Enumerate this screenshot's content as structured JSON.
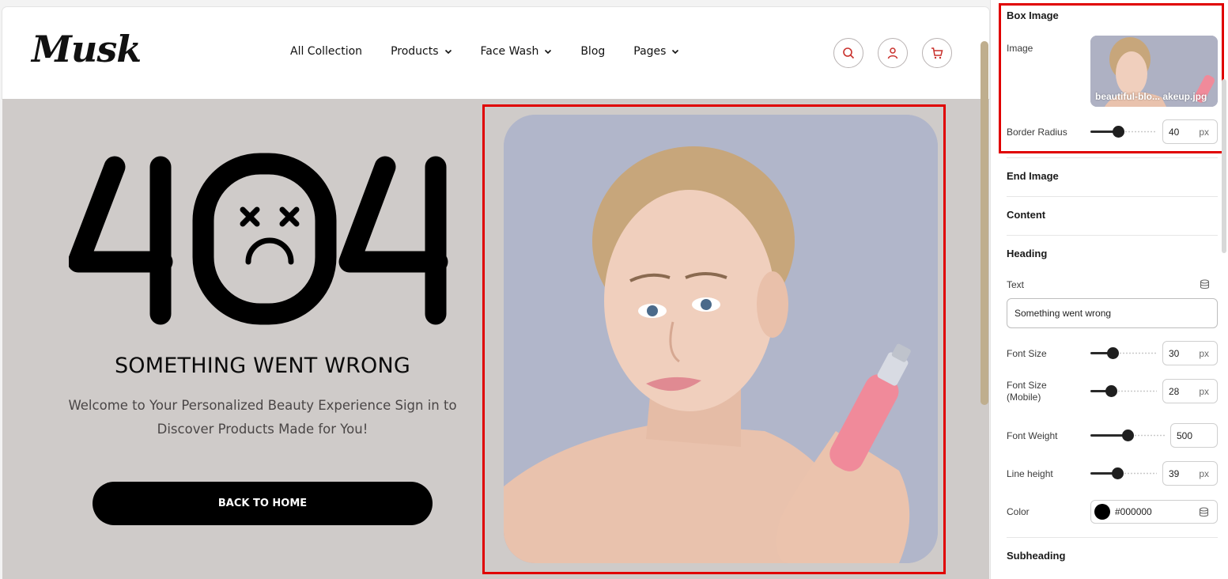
{
  "header": {
    "logo": "Musk",
    "nav": [
      {
        "label": "All Collection",
        "dropdown": false
      },
      {
        "label": "Products",
        "dropdown": true
      },
      {
        "label": "Face Wash",
        "dropdown": true
      },
      {
        "label": "Blog",
        "dropdown": false
      },
      {
        "label": "Pages",
        "dropdown": true
      }
    ],
    "icons": [
      "search-icon",
      "user-icon",
      "cart-icon"
    ],
    "accent": "#c9302c"
  },
  "hero": {
    "error_code": "404",
    "heading": "SOMETHING WENT WRONG",
    "subtext": "Welcome to Your Personalized Beauty Experience Sign in to Discover Products Made for You!",
    "button": "BACK TO HOME",
    "background": "#cfcbc9"
  },
  "panel": {
    "box_image": {
      "title": "Box Image",
      "image_label": "Image",
      "image_name": "beautiful-blo... akeup.jpg",
      "border_radius_label": "Border Radius",
      "border_radius_value": "40",
      "border_radius_unit": "px",
      "border_radius_level": 0.4
    },
    "end_image": {
      "title": "End Image"
    },
    "content": {
      "title": "Content"
    },
    "heading": {
      "title": "Heading",
      "text_label": "Text",
      "text_value": "Something went wrong",
      "font_size_label": "Font Size",
      "font_size_value": "30",
      "font_size_level": 0.3,
      "font_size_mobile_label": "Font Size (Mobile)",
      "font_size_mobile_value": "28",
      "font_size_mobile_level": 0.28,
      "font_weight_label": "Font Weight",
      "font_weight_value": "500",
      "font_weight_level": 0.5,
      "line_height_label": "Line height",
      "line_height_value": "39",
      "line_height_level": 0.39,
      "color_label": "Color",
      "color_value": "#000000",
      "unit": "px"
    },
    "subheading": {
      "title": "Subheading"
    }
  }
}
